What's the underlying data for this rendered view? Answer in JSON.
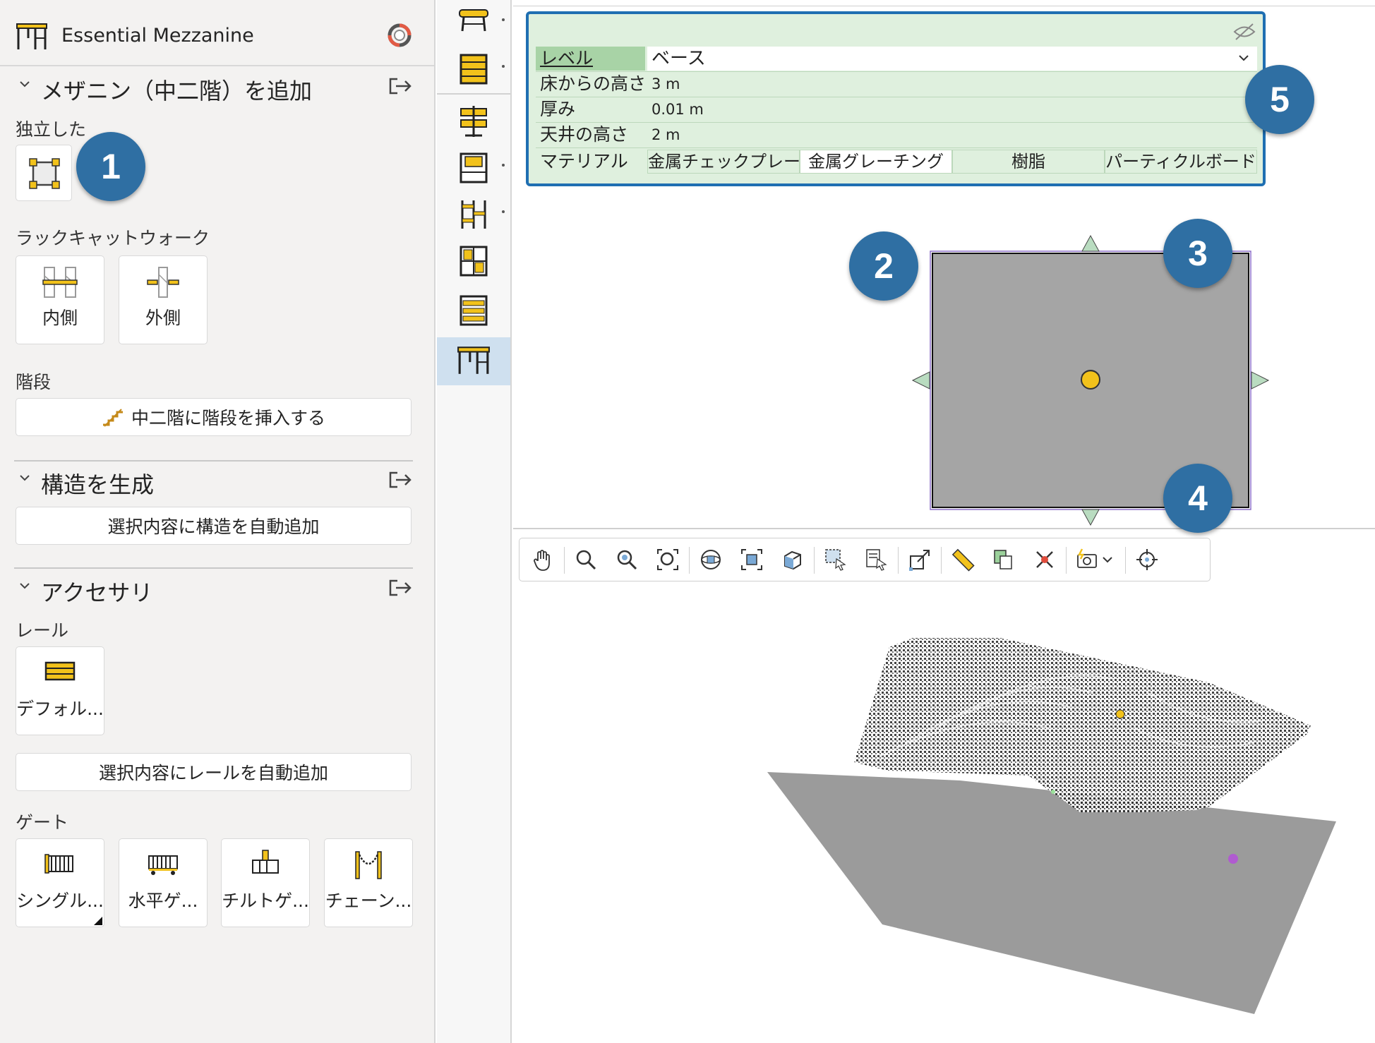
{
  "app": {
    "title": "Essential Mezzanine",
    "app_icon": "mezzanine-icon",
    "help_icon": "lifebuoy-icon"
  },
  "sections": {
    "add_mezzanine": {
      "title": "メザニン（中二階）を追加",
      "standalone_label": "独立した",
      "rack_catwalk_label": "ラックキャットウォーク",
      "rack_inside": "内側",
      "rack_outside": "外側",
      "stairs_label": "階段",
      "insert_stairs_button": "中二階に階段を挿入する"
    },
    "generate_structure": {
      "title": "構造を生成",
      "auto_add_button": "選択内容に構造を自動追加"
    },
    "accessories": {
      "title": "アクセサリ",
      "rail_label": "レール",
      "rail_default": "デフォル...",
      "auto_rail_button": "選択内容にレールを自動追加",
      "gate_label": "ゲート",
      "gates": [
        "シングル...",
        "水平ゲ...",
        "チルトゲ...",
        "チェーン..."
      ]
    }
  },
  "properties": {
    "level_key": "レベル",
    "level_value": "ベース",
    "height_key": "床からの高さ",
    "height_value": "3 m",
    "thickness_key": "厚み",
    "thickness_value": "0.01 m",
    "ceiling_key": "天井の高さ",
    "ceiling_value": "2 m",
    "material_key": "マテリアル",
    "materials": [
      "金属チェックプレート",
      "金属グレーチング",
      "樹脂",
      "パーティクルボード"
    ],
    "selected_material_index": 1
  },
  "callouts": [
    "1",
    "2",
    "3",
    "4",
    "5"
  ],
  "colors": {
    "accent_blue": "#2f6fa3",
    "props_border": "#1f6fb2",
    "props_bg": "#dff0de",
    "props_key_hi": "#a8d3a6",
    "slab_gray": "#a5a5a5",
    "icon_yellow": "#f2c21b"
  }
}
